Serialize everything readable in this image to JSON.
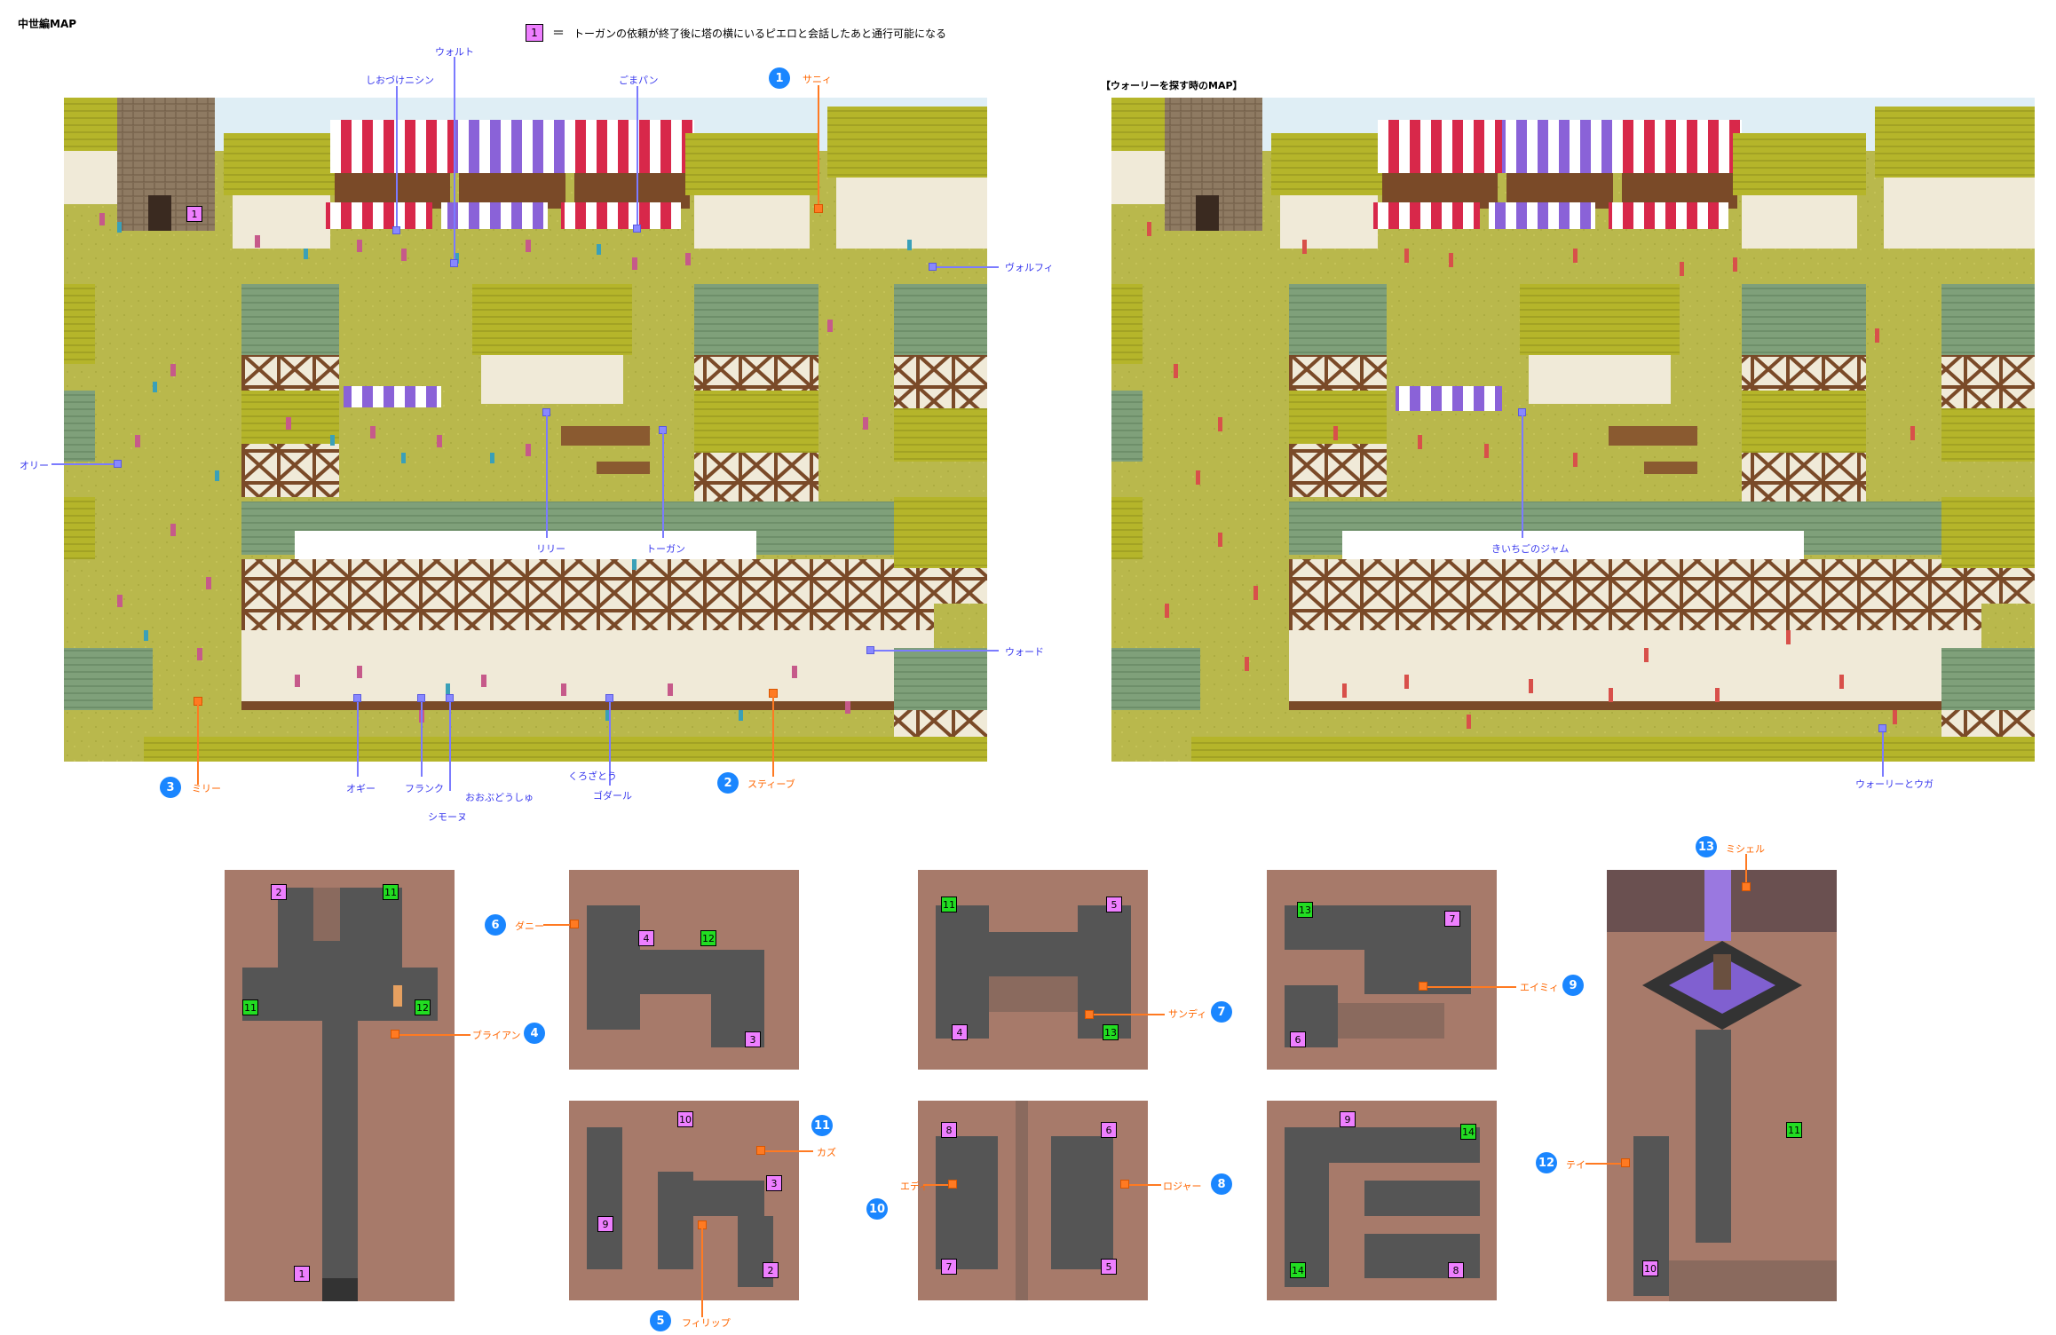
{
  "page_title": "中世編MAP",
  "legend": {
    "marker": "1",
    "equals": "＝",
    "text": "トーガンの依頼が終了後に塔の横にいるピエロと会話したあと通行可能になる"
  },
  "map2_title": "【ウォーリーを探す時のMAP】",
  "town_labels": {
    "sani": "サニィ",
    "shiodzuke": "しおづけニシン",
    "walt": "ウォルト",
    "gomapan": "ごまパン",
    "wolfie": "ヴォルフィ",
    "olly": "オリー",
    "lily": "リリー",
    "togan": "トーガン",
    "ward": "ウォード",
    "milly": "ミリー",
    "oggy": "オギー",
    "frank": "フランク",
    "simone": "シモーヌ",
    "oobudou": "おおぶどうしゅ",
    "kurozatou": "くろざとう",
    "godar": "ゴダール",
    "steve": "スティーブ",
    "jam": "きいちごのジャム",
    "wally": "ウォーリーとウガ"
  },
  "npc_labels": {
    "danny": "ダニー",
    "brian": "ブライアン",
    "sandy": "サンディ",
    "amy": "エイミィ",
    "michel": "ミシェル",
    "kaz": "カズ",
    "eddie": "エディ",
    "roger": "ロジャー",
    "tei": "テイ",
    "philip": "フィリップ"
  },
  "badges": [
    "1",
    "2",
    "3",
    "4",
    "5",
    "6",
    "7",
    "8",
    "9",
    "10",
    "11",
    "12",
    "13"
  ],
  "colors": {
    "grass": "#b9b84c",
    "roof_yellow": "#b5b52a",
    "roof_green": "#7fa07a",
    "wall": "#f0ead8",
    "timber": "#7a4a28",
    "stone": "#a77a6a",
    "floor": "#555555",
    "pink_marker": "#ee7fff",
    "green_marker": "#22dd22",
    "badge_blue": "#1a86ff",
    "label_blue": "#3a3aee",
    "label_orange": "#ff6600"
  }
}
